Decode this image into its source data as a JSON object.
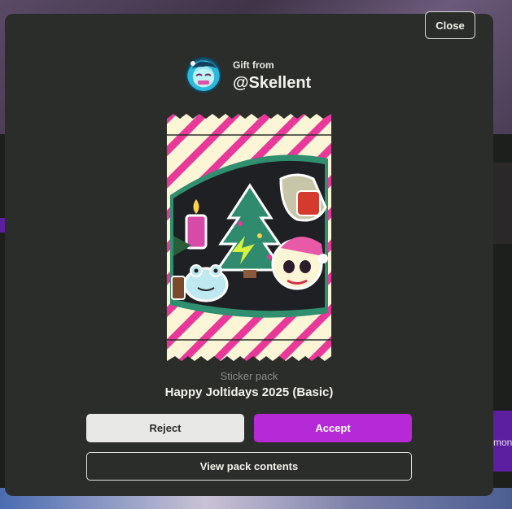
{
  "dialog": {
    "close_label": "Close",
    "gift_from_label": "Gift from",
    "sender_handle": "@Skellent",
    "pack_type_label": "Sticker pack",
    "pack_name": "Happy Joltidays 2025 (Basic)",
    "reject_label": "Reject",
    "accept_label": "Accept",
    "view_contents_label": "View pack contents"
  },
  "background": {
    "partial_text": "mont"
  },
  "colors": {
    "modal_bg": "#2b2d2a",
    "accept_bg": "#b52ad6",
    "reject_bg": "#e8e9e6",
    "pack_stripe": "#e8399a",
    "pack_base": "#fdf6d6",
    "pack_rim": "#2f8f6e"
  }
}
